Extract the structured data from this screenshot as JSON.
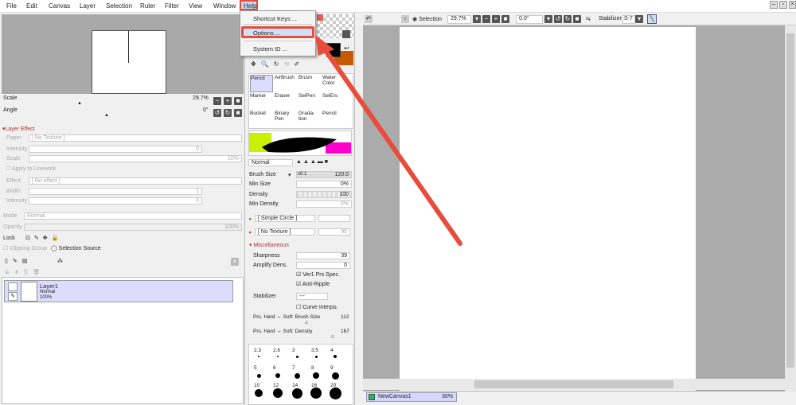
{
  "menu": {
    "file": "File",
    "edit": "Edit",
    "canvas": "Canvas",
    "layer": "Layer",
    "selection": "Selection",
    "ruler": "Ruler",
    "filter": "Filter",
    "view": "View",
    "window": "Window",
    "help": "Help"
  },
  "help_menu": {
    "shortcut_keys": "Shortcut Keys ...",
    "options": "Options ...",
    "system_id": "System ID ..."
  },
  "navigator": {
    "scale_label": "Scale",
    "scale_value": "29.7%",
    "angle_label": "Angle",
    "angle_value": "0°"
  },
  "layer_effect": {
    "header": "Layer Effect",
    "paper_label": "Paper",
    "paper_value": "[ No Texture ]",
    "intensity_label": "Intensity",
    "intensity_value": "0",
    "scale_label": "Scale",
    "scale_value": "10%",
    "apply_linework": "Apply to Linework",
    "effect_label": "Effect",
    "effect_value": "[ No effect ]",
    "width_label": "Width",
    "width_value": "1",
    "intensity2_label": "Intensity",
    "intensity2_value": "0"
  },
  "layer_props": {
    "mode_label": "Mode",
    "mode_value": "Normal",
    "opacity_label": "Opacity",
    "opacity_value": "100%",
    "lock_label": "Lock",
    "clipping_group": "Clipping Group",
    "selection_source": "Selection Source"
  },
  "layers": [
    {
      "name": "Layer1",
      "mode": "Normal",
      "opacity": "100%"
    }
  ],
  "tools": [
    [
      "Pencil",
      "AirBrush",
      "Brush",
      "Water Color"
    ],
    [
      "Marker",
      "Eraser",
      "SelPen",
      "SelErs"
    ],
    [
      "Bucket",
      "Binary Pen",
      "Grada- tion",
      "Pencil"
    ]
  ],
  "brush": {
    "blend": "Normal",
    "size_label": "Brush Size",
    "size_mult": "x0.1",
    "size_value": "120.0",
    "min_size_label": "Min Size",
    "min_size_value": "0%",
    "density_label": "Density",
    "density_value": "100",
    "min_density_label": "Min Density",
    "min_density_value": "0%",
    "shape": "[ Simple Circle ]",
    "texture": "[ No Texture ]",
    "texture_amount": "95",
    "misc_header": "Miscellaneous",
    "sharpness_label": "Sharpness",
    "sharpness_value": "39",
    "amplify_label": "Amplify Dens.",
    "amplify_value": "0",
    "ver1_prs": "Ver1 Prs Spec.",
    "anti_ripple": "Anti-Ripple",
    "stabilizer_label": "Stabilizer",
    "stabilizer_value": "---",
    "curve_interpo": "Curve Interpo.",
    "prs_size_label": "Prs. Hard ⇔ Soft: Brush Size",
    "prs_size_value": "112",
    "prs_density_label": "Prs. Hard ⇔ Soft: Density",
    "prs_density_value": "167"
  },
  "brush_sizes": [
    "2.3",
    "2.6",
    "3",
    "3.5",
    "4",
    "5",
    "6",
    "7",
    "8",
    "9",
    "10",
    "12",
    "14",
    "16",
    "20"
  ],
  "canvas_toolbar": {
    "selection_label": "Selection",
    "zoom": "29.7%",
    "angle": "0.0°",
    "stabilizer_label": "Stabilizer",
    "stabilizer_value": "S-7"
  },
  "canvas_tab": {
    "name": "NewCanvas1",
    "zoom": "30%"
  },
  "colors": {
    "accent_red": "#e74c3c",
    "main_color": "#000000",
    "sub_color": "#c55a00",
    "layer_highlight": "#dcdcff"
  }
}
